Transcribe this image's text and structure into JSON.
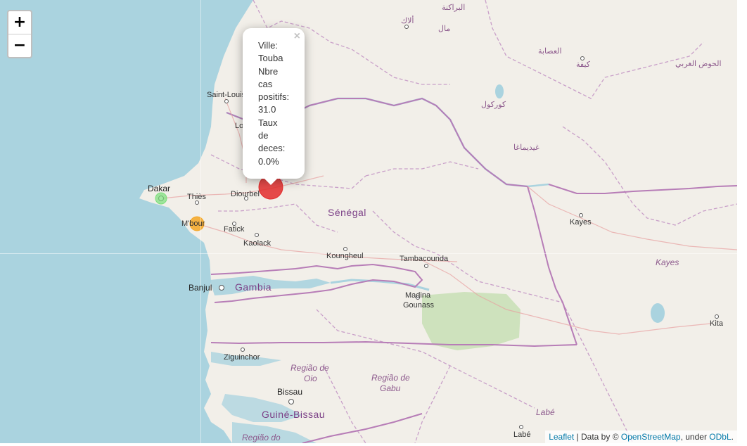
{
  "zoom": {
    "in_label": "+",
    "out_label": "−"
  },
  "popup": {
    "close_label": "×",
    "lines": [
      "Ville:",
      "Touba",
      "Nbre",
      "cas",
      "positifs:",
      "31.0",
      "Taux",
      "de",
      "deces:",
      "0.0%"
    ]
  },
  "labels": {
    "senegal": "Sénégal",
    "gambia": "Gambia",
    "guinee_bissau": "Guiné-Bissau",
    "dakar": "Dakar",
    "thies": "Thiès",
    "mbour": "M'bour",
    "diourbel": "Diourbel",
    "fatick": "Fatick",
    "kaolack": "Kaolack",
    "koungheul": "Koungheul",
    "tambacounda": "Tambacounda",
    "saint_louis": "Saint-Louis",
    "louga": "Lo",
    "banjul": "Banjul",
    "ziguinchor": "Ziguinchor",
    "bissau": "Bissau",
    "kayes": "Kayes",
    "kayes_region": "Kayes",
    "kita": "Kita",
    "labe": "Labé",
    "labe_region": "Labé",
    "madina_gounass_1": "Madina",
    "madina_gounass_2": "Gounass",
    "regiao_oio_1": "Região de",
    "regiao_oio_2": "Oio",
    "regiao_gabu_1": "Região de",
    "regiao_gabu_2": "Gabu",
    "regiao_bottom": "Região do",
    "ar_brakna": "البراكنة",
    "ar_aleg": "ألاك",
    "ar_mal": "مال",
    "ar_assaba": "العصابة",
    "ar_kiffa": "كيفة",
    "ar_hodh": "الحوض الغربي",
    "ar_gorgol": "كوركول",
    "ar_guidimakha": "غيديماغا"
  },
  "markers": [
    {
      "name": "Touba",
      "color": "#e32b2b"
    },
    {
      "name": "Dakar",
      "color": "#7be07b"
    },
    {
      "name": "M'bour",
      "color": "#f5a623"
    }
  ],
  "attribution": {
    "leaflet": "Leaflet",
    "sep1": " | Data by © ",
    "osm": "OpenStreetMap",
    "sep2": ", under ",
    "odbl": "ODbL",
    "end": "."
  }
}
